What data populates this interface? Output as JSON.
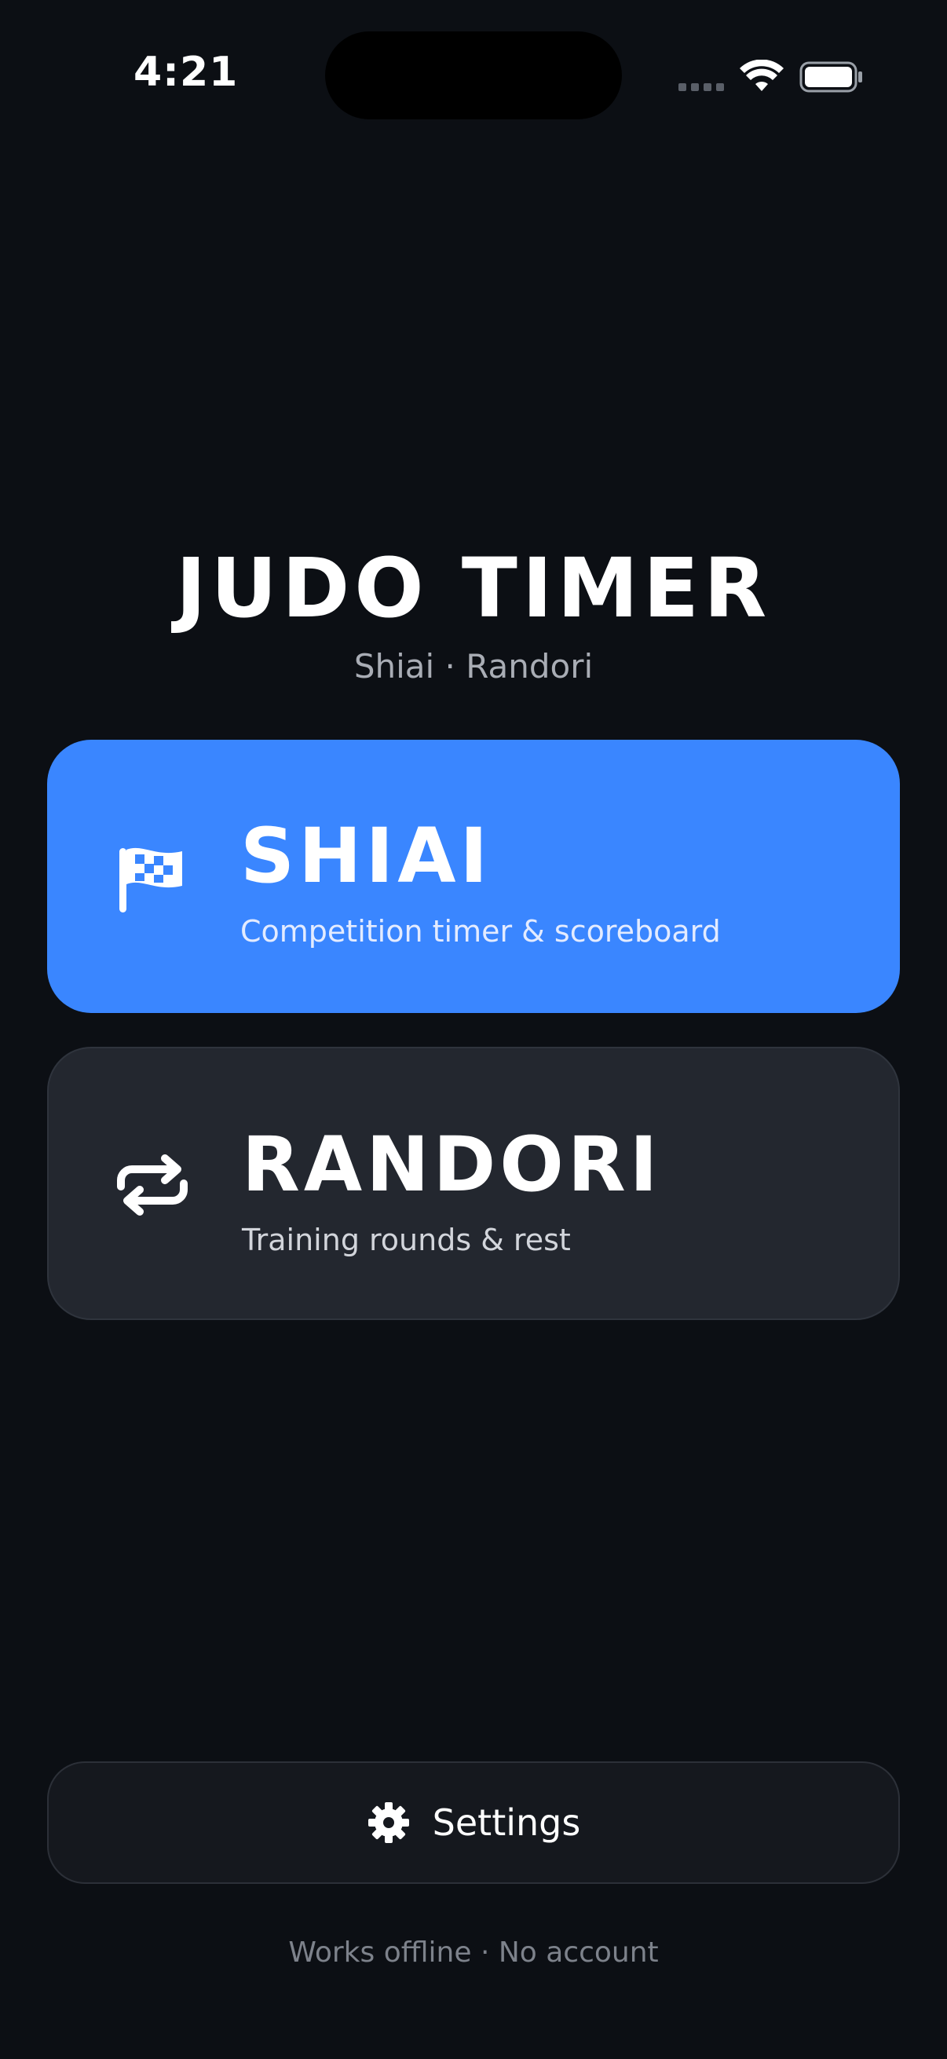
{
  "status_bar": {
    "time": "4:21"
  },
  "header": {
    "title": "JUDO TIMER",
    "subtitle": "Shiai · Randori"
  },
  "modes": [
    {
      "title": "SHIAI",
      "description": "Competition timer & scoreboard",
      "icon": "checkered-flag-icon",
      "color": "#3a86ff"
    },
    {
      "title": "RANDORI",
      "description": "Training rounds & rest",
      "icon": "repeat-arrows-icon",
      "color": "#23272f"
    }
  ],
  "settings": {
    "label": "Settings",
    "icon": "gear-icon"
  },
  "footer": {
    "note": "Works offline · No account"
  }
}
